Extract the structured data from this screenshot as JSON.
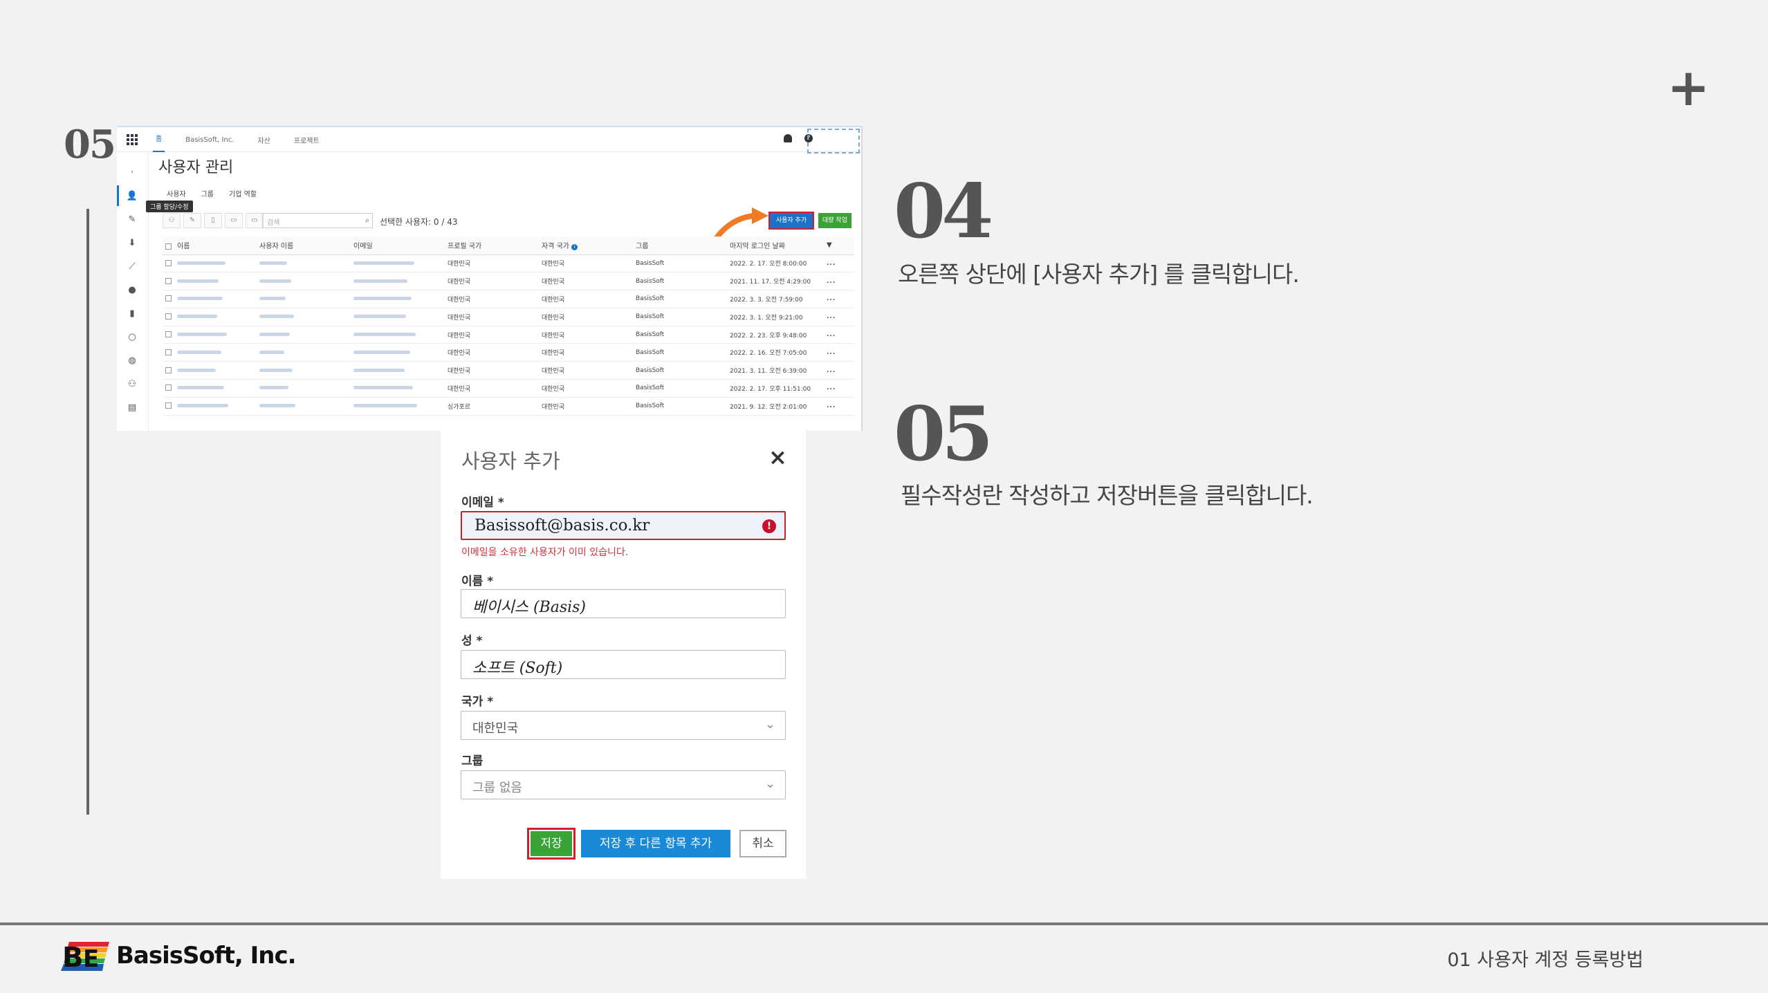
{
  "slide": {
    "number": "05",
    "plus": "+",
    "footer_label": "01 사용자 계정 등록방법",
    "brand": "BasisSoft, Inc."
  },
  "screenshot": {
    "nav_tabs": [
      "홈",
      "BasisSoft, Inc.",
      "자산",
      "프로젝트"
    ],
    "page_title": "사용자 관리",
    "sub_tabs": [
      "사용자",
      "그룹",
      "기업 역할"
    ],
    "tooltip": "그룹 할당/수정",
    "search_placeholder": "검색",
    "selected_count": "선택한 사용자: 0 / 43",
    "add_user_button": "사용자 추가",
    "bulk_button": "대량 작업",
    "columns": [
      "이름",
      "사용자 이름",
      "이메일",
      "프로필 국가",
      "자격 국가",
      "그룹",
      "마지막 로그인 날짜"
    ],
    "rows": [
      {
        "profile_country": "대한민국",
        "cert_country": "대한민국",
        "group": "BasisSoft",
        "last_login": "2022. 2. 17. 오전 8:00:00"
      },
      {
        "profile_country": "대한민국",
        "cert_country": "대한민국",
        "group": "BasisSoft",
        "last_login": "2021. 11. 17. 오전 4:29:00"
      },
      {
        "profile_country": "대한민국",
        "cert_country": "대한민국",
        "group": "BasisSoft",
        "last_login": "2022. 3. 3. 오전 7:59:00"
      },
      {
        "profile_country": "대한민국",
        "cert_country": "대한민국",
        "group": "BasisSoft",
        "last_login": "2022. 3. 1. 오전 9:21:00"
      },
      {
        "profile_country": "대한민국",
        "cert_country": "대한민국",
        "group": "BasisSoft",
        "last_login": "2022. 2. 23. 오후 9:48:00"
      },
      {
        "profile_country": "대한민국",
        "cert_country": "대한민국",
        "group": "BasisSoft",
        "last_login": "2022. 2. 16. 오전 7:05:00"
      },
      {
        "profile_country": "대한민국",
        "cert_country": "대한민국",
        "group": "BasisSoft",
        "last_login": "2021. 3. 11. 오전 6:39:00"
      },
      {
        "profile_country": "대한민국",
        "cert_country": "대한민국",
        "group": "BasisSoft",
        "last_login": "2022. 2. 17. 오후 11:51:00"
      },
      {
        "profile_country": "싱가포르",
        "cert_country": "대한민국",
        "group": "BasisSoft",
        "last_login": "2021. 9. 12. 오전 2:01:00"
      }
    ],
    "more_icon": "..."
  },
  "dialog": {
    "title": "사용자 추가",
    "close": "×",
    "email_label": "이메일 *",
    "email_value": "Basissoft@basis.co.kr",
    "email_error": "이메일을 소유한 사용자가 이미 있습니다.",
    "first_name_label": "이름 *",
    "first_name_value": "베이시스 (Basis)",
    "last_name_label": "성 *",
    "last_name_value": "소프트 (Soft)",
    "country_label": "국가 *",
    "country_value": "대한민국",
    "group_label": "그룹",
    "group_value": "그룹 없음",
    "save": "저장",
    "save_add": "저장 후 다른 항목 추가",
    "cancel": "취소"
  },
  "steps": [
    {
      "num": "04",
      "text": "오른쪽 상단에 [사용자 추가] 를 클릭합니다."
    },
    {
      "num": "05",
      "text": "필수작성란 작성하고 저장버튼을 클릭합니다."
    }
  ],
  "colors": {
    "primary_blue": "#1a73c8",
    "green": "#3aa335",
    "error_red": "#d0202a",
    "arrow_orange": "#f07a26"
  }
}
